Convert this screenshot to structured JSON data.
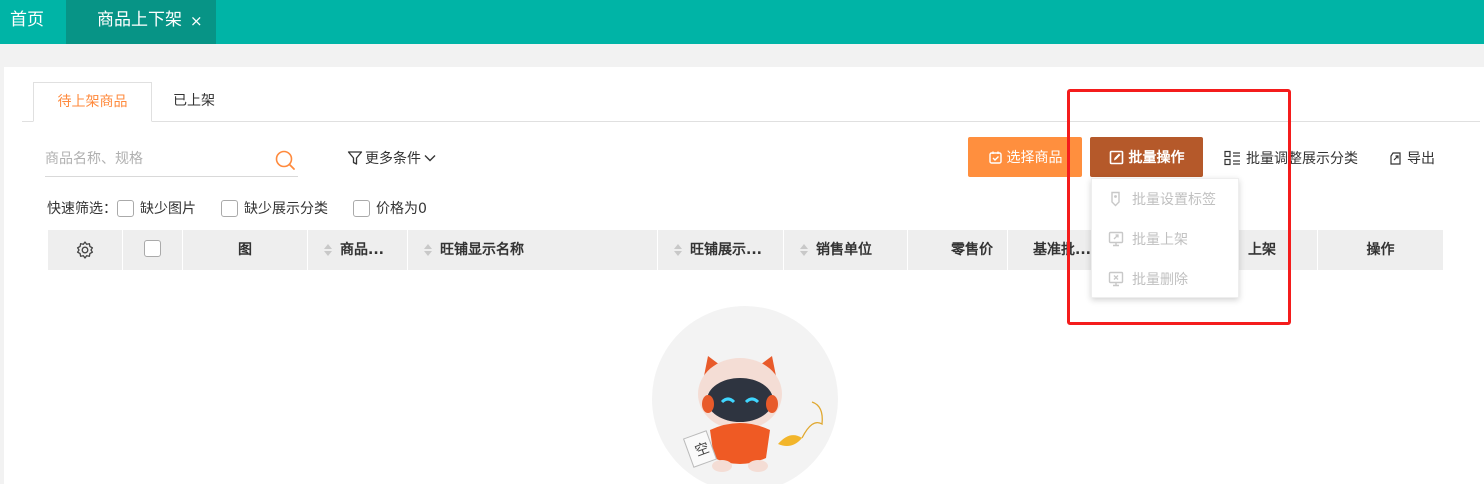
{
  "topbar": {
    "home_tab": "首页",
    "active_tab": "商品上下架",
    "close_symbol": "×",
    "color": "#00b4a6",
    "active_color": "#079486"
  },
  "subtabs": [
    {
      "label": "待上架商品",
      "active": true
    },
    {
      "label": "已上架",
      "active": false
    }
  ],
  "search": {
    "placeholder": "商品名称、规格",
    "icon": "search-icon"
  },
  "filter": {
    "more_conditions": "更多条件"
  },
  "toolbar": {
    "select_goods": "选择商品",
    "batch_ops": "批量操作",
    "batch_adjust": "批量调整展示分类",
    "export": "导出",
    "select_color": "#ff8f3e",
    "batch_color": "#b5592a"
  },
  "quick_filter": {
    "label": "快速筛选：",
    "options": [
      "缺少图片",
      "缺少展示分类",
      "价格为0"
    ]
  },
  "table": {
    "columns": [
      "图",
      "商品...",
      "旺铺显示名称",
      "旺铺展示...",
      "销售单位",
      "零售价",
      "基准批...",
      "上架",
      "操作"
    ]
  },
  "dropdown": {
    "items": [
      "批量设置标签",
      "批量上架",
      "批量删除"
    ]
  },
  "highlight_color": "#f41c1c",
  "empty_state": {
    "badge_char": "空"
  }
}
